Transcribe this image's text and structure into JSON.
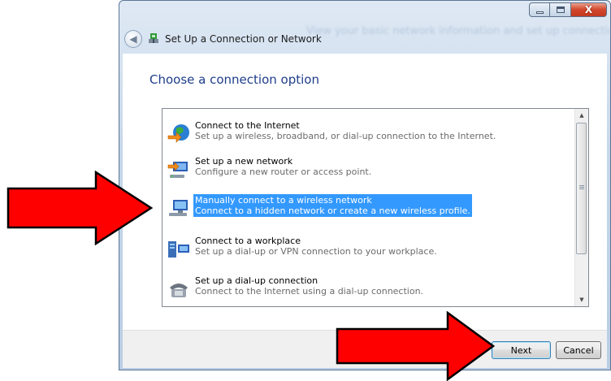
{
  "window": {
    "title": "Set Up a Connection or Network",
    "blurred_background_text": "View your basic network information and set up connections"
  },
  "caption_buttons": {
    "minimize": "minimize",
    "maximize": "maximize",
    "close": "X"
  },
  "main": {
    "heading": "Choose a connection option",
    "options": [
      {
        "title": "Connect to the Internet",
        "description": "Set up a wireless, broadband, or dial-up connection to the Internet.",
        "icon": "globe-icon",
        "selected": false
      },
      {
        "title": "Set up a new network",
        "description": "Configure a new router or access point.",
        "icon": "router-icon",
        "selected": false
      },
      {
        "title": "Manually connect to a wireless network",
        "description": "Connect to a hidden network or create a new wireless profile.",
        "icon": "wireless-computer-icon",
        "selected": true
      },
      {
        "title": "Connect to a workplace",
        "description": "Set up a dial-up or VPN connection to your workplace.",
        "icon": "workplace-icon",
        "selected": false
      },
      {
        "title": "Set up a dial-up connection",
        "description": "Connect to the Internet using a dial-up connection.",
        "icon": "telephone-icon",
        "selected": false
      }
    ]
  },
  "footer": {
    "next_label": "Next",
    "cancel_label": "Cancel"
  },
  "colors": {
    "selection": "#3399ff",
    "heading": "#1e3d8a",
    "annotation_arrow": "#ff0000"
  }
}
